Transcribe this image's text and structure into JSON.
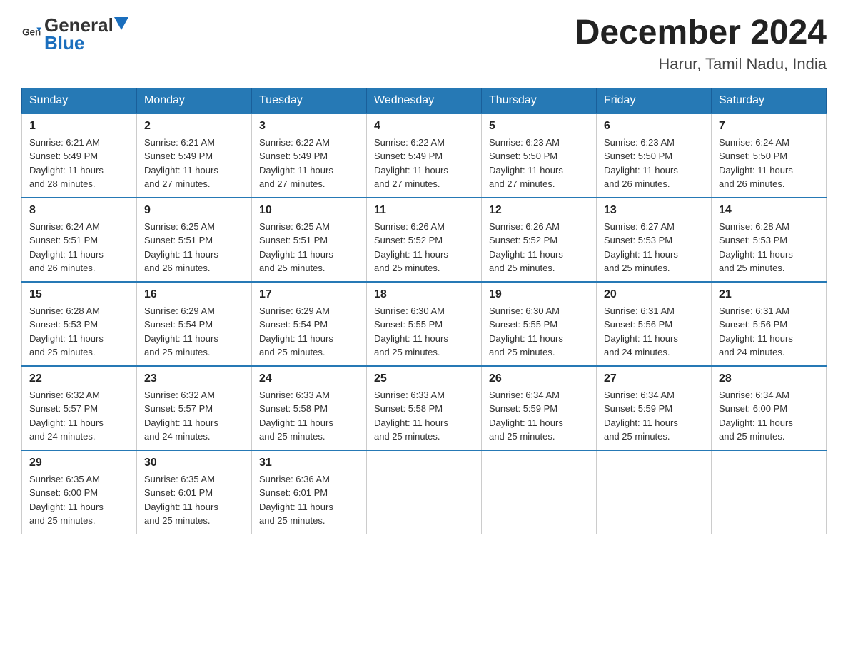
{
  "header": {
    "logo_general": "General",
    "logo_blue": "Blue",
    "month": "December 2024",
    "location": "Harur, Tamil Nadu, India"
  },
  "weekdays": [
    "Sunday",
    "Monday",
    "Tuesday",
    "Wednesday",
    "Thursday",
    "Friday",
    "Saturday"
  ],
  "weeks": [
    [
      {
        "day": "1",
        "sunrise": "6:21 AM",
        "sunset": "5:49 PM",
        "daylight": "11 hours and 28 minutes."
      },
      {
        "day": "2",
        "sunrise": "6:21 AM",
        "sunset": "5:49 PM",
        "daylight": "11 hours and 27 minutes."
      },
      {
        "day": "3",
        "sunrise": "6:22 AM",
        "sunset": "5:49 PM",
        "daylight": "11 hours and 27 minutes."
      },
      {
        "day": "4",
        "sunrise": "6:22 AM",
        "sunset": "5:49 PM",
        "daylight": "11 hours and 27 minutes."
      },
      {
        "day": "5",
        "sunrise": "6:23 AM",
        "sunset": "5:50 PM",
        "daylight": "11 hours and 27 minutes."
      },
      {
        "day": "6",
        "sunrise": "6:23 AM",
        "sunset": "5:50 PM",
        "daylight": "11 hours and 26 minutes."
      },
      {
        "day": "7",
        "sunrise": "6:24 AM",
        "sunset": "5:50 PM",
        "daylight": "11 hours and 26 minutes."
      }
    ],
    [
      {
        "day": "8",
        "sunrise": "6:24 AM",
        "sunset": "5:51 PM",
        "daylight": "11 hours and 26 minutes."
      },
      {
        "day": "9",
        "sunrise": "6:25 AM",
        "sunset": "5:51 PM",
        "daylight": "11 hours and 26 minutes."
      },
      {
        "day": "10",
        "sunrise": "6:25 AM",
        "sunset": "5:51 PM",
        "daylight": "11 hours and 25 minutes."
      },
      {
        "day": "11",
        "sunrise": "6:26 AM",
        "sunset": "5:52 PM",
        "daylight": "11 hours and 25 minutes."
      },
      {
        "day": "12",
        "sunrise": "6:26 AM",
        "sunset": "5:52 PM",
        "daylight": "11 hours and 25 minutes."
      },
      {
        "day": "13",
        "sunrise": "6:27 AM",
        "sunset": "5:53 PM",
        "daylight": "11 hours and 25 minutes."
      },
      {
        "day": "14",
        "sunrise": "6:28 AM",
        "sunset": "5:53 PM",
        "daylight": "11 hours and 25 minutes."
      }
    ],
    [
      {
        "day": "15",
        "sunrise": "6:28 AM",
        "sunset": "5:53 PM",
        "daylight": "11 hours and 25 minutes."
      },
      {
        "day": "16",
        "sunrise": "6:29 AM",
        "sunset": "5:54 PM",
        "daylight": "11 hours and 25 minutes."
      },
      {
        "day": "17",
        "sunrise": "6:29 AM",
        "sunset": "5:54 PM",
        "daylight": "11 hours and 25 minutes."
      },
      {
        "day": "18",
        "sunrise": "6:30 AM",
        "sunset": "5:55 PM",
        "daylight": "11 hours and 25 minutes."
      },
      {
        "day": "19",
        "sunrise": "6:30 AM",
        "sunset": "5:55 PM",
        "daylight": "11 hours and 25 minutes."
      },
      {
        "day": "20",
        "sunrise": "6:31 AM",
        "sunset": "5:56 PM",
        "daylight": "11 hours and 24 minutes."
      },
      {
        "day": "21",
        "sunrise": "6:31 AM",
        "sunset": "5:56 PM",
        "daylight": "11 hours and 24 minutes."
      }
    ],
    [
      {
        "day": "22",
        "sunrise": "6:32 AM",
        "sunset": "5:57 PM",
        "daylight": "11 hours and 24 minutes."
      },
      {
        "day": "23",
        "sunrise": "6:32 AM",
        "sunset": "5:57 PM",
        "daylight": "11 hours and 24 minutes."
      },
      {
        "day": "24",
        "sunrise": "6:33 AM",
        "sunset": "5:58 PM",
        "daylight": "11 hours and 25 minutes."
      },
      {
        "day": "25",
        "sunrise": "6:33 AM",
        "sunset": "5:58 PM",
        "daylight": "11 hours and 25 minutes."
      },
      {
        "day": "26",
        "sunrise": "6:34 AM",
        "sunset": "5:59 PM",
        "daylight": "11 hours and 25 minutes."
      },
      {
        "day": "27",
        "sunrise": "6:34 AM",
        "sunset": "5:59 PM",
        "daylight": "11 hours and 25 minutes."
      },
      {
        "day": "28",
        "sunrise": "6:34 AM",
        "sunset": "6:00 PM",
        "daylight": "11 hours and 25 minutes."
      }
    ],
    [
      {
        "day": "29",
        "sunrise": "6:35 AM",
        "sunset": "6:00 PM",
        "daylight": "11 hours and 25 minutes."
      },
      {
        "day": "30",
        "sunrise": "6:35 AM",
        "sunset": "6:01 PM",
        "daylight": "11 hours and 25 minutes."
      },
      {
        "day": "31",
        "sunrise": "6:36 AM",
        "sunset": "6:01 PM",
        "daylight": "11 hours and 25 minutes."
      },
      null,
      null,
      null,
      null
    ]
  ],
  "labels": {
    "sunrise": "Sunrise:",
    "sunset": "Sunset:",
    "daylight": "Daylight:"
  }
}
